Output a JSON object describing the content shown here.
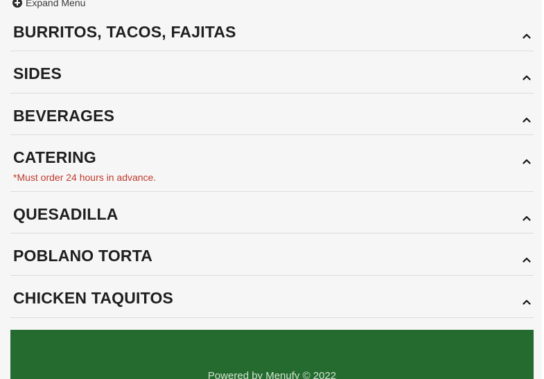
{
  "expand_menu": {
    "label": "Expand Menu",
    "icon": "plus-circle-icon"
  },
  "categories": [
    {
      "title": "BURRITOS, TACOS, FAJITAS",
      "note": ""
    },
    {
      "title": "SIDES",
      "note": ""
    },
    {
      "title": "BEVERAGES",
      "note": ""
    },
    {
      "title": "CATERING",
      "note": "*Must order 24 hours in advance."
    },
    {
      "title": "QUESADILLA",
      "note": ""
    },
    {
      "title": "POBLANO TORTA",
      "note": ""
    },
    {
      "title": "CHICKEN TAQUITOS",
      "note": ""
    }
  ],
  "footer": {
    "text": "Powered by Menufy © 2022"
  },
  "colors": {
    "footer_bg": "#256b2f",
    "note_text": "#c0392b"
  }
}
